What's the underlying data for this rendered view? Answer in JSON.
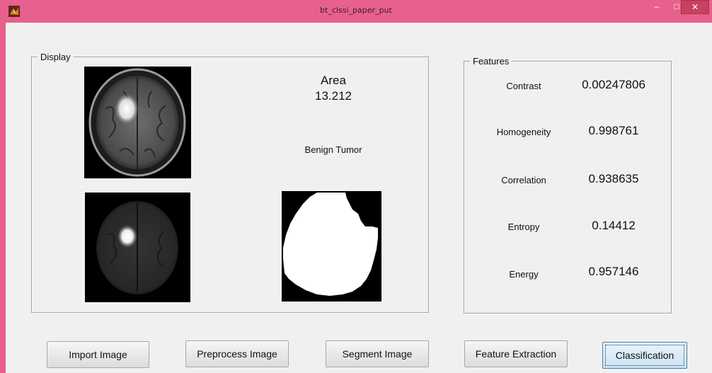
{
  "window": {
    "title": "bt_clssi_paper_put",
    "minimize_glyph": "–",
    "maximize_glyph": "□",
    "close_glyph": "✕"
  },
  "display": {
    "panel_title": "Display",
    "area_label": "Area",
    "area_value": "13.212",
    "result": "Benign Tumor"
  },
  "features": {
    "panel_title": "Features",
    "items": [
      {
        "label": "Contrast",
        "value": "0.00247806"
      },
      {
        "label": "Homogeneity",
        "value": "0.998761"
      },
      {
        "label": "Correlation",
        "value": "0.938635"
      },
      {
        "label": "Entropy",
        "value": "0.14412"
      },
      {
        "label": "Energy",
        "value": "0.957146"
      }
    ]
  },
  "buttons": {
    "import": "Import Image",
    "preprocess": "Preprocess Image",
    "segment": "Segment Image",
    "feature_extraction": "Feature Extraction",
    "classification": "Classification"
  }
}
